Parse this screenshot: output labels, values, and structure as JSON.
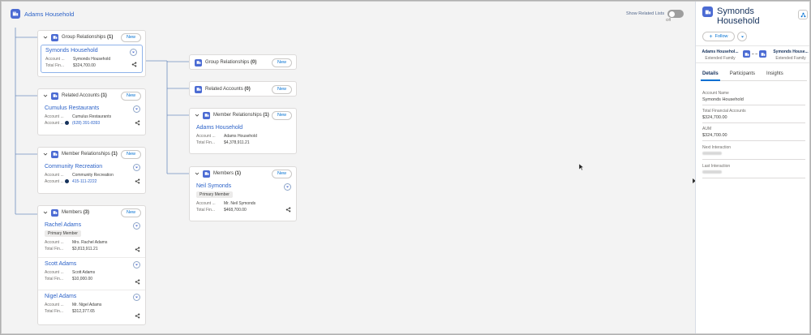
{
  "header": {
    "household_name": "Adams Household",
    "toggle_label": "Show Related Lists",
    "toggle_state": "Off"
  },
  "left_column": {
    "group_relationships": {
      "title": "Group Relationships",
      "count": "(1)",
      "new_label": "New",
      "records": [
        {
          "name": "Symonds Household",
          "lab1": "Account ...",
          "val1": "Symonds Household",
          "lab2": "Total Fin...",
          "val2": "$324,700.00"
        }
      ]
    },
    "related_accounts": {
      "title": "Related Accounts",
      "count": "(1)",
      "new_label": "New",
      "records": [
        {
          "name": "Cumulus Restaurants",
          "lab1": "Account ...",
          "val1": "Cumulus Restaurants",
          "lab2": "Account ...",
          "val2": "(628) 391-8393"
        }
      ]
    },
    "member_relationships": {
      "title": "Member Relationships",
      "count": "(1)",
      "new_label": "New",
      "records": [
        {
          "name": "Community Recreation",
          "lab1": "Account ...",
          "val1": "Community Recreation",
          "lab2": "Account ...",
          "val2": "415-111-2222"
        }
      ]
    },
    "members": {
      "title": "Members",
      "count": "(3)",
      "new_label": "New",
      "records": [
        {
          "name": "Rachel Adams",
          "badge": "Primary Member",
          "lab1": "Account ...",
          "val1": "Mrs. Rachel Adams",
          "lab2": "Total Fin...",
          "val2": "$3,813,911.21"
        },
        {
          "name": "Scott Adams",
          "lab1": "Account ...",
          "val1": "Scott Adams",
          "lab2": "Total Fin...",
          "val2": "$10,000.00"
        },
        {
          "name": "Nigel Adams",
          "lab1": "Account ...",
          "val1": "Mr. Nigel Adams",
          "lab2": "Total Fin...",
          "val2": "$312,377.65"
        }
      ]
    }
  },
  "mid_column": {
    "group_relationships": {
      "title": "Group Relationships",
      "count": "(0)",
      "new_label": "New"
    },
    "related_accounts": {
      "title": "Related Accounts",
      "count": "(0)",
      "new_label": "New"
    },
    "member_relationships": {
      "title": "Member Relationships",
      "count": "(1)",
      "new_label": "New",
      "records": [
        {
          "name": "Adams Household",
          "lab1": "Account ...",
          "val1": "Adams Household",
          "lab2": "Total Fin...",
          "val2": "$4,378,911.21"
        }
      ]
    },
    "members": {
      "title": "Members",
      "count": "(1)",
      "new_label": "New",
      "records": [
        {
          "name": "Neil Symonds",
          "badge": "Primary Member",
          "lab1": "Account ...",
          "val1": "Mr. Neil Symonds",
          "lab2": "Total Fin...",
          "val2": "$468,700.00"
        }
      ]
    }
  },
  "right_panel": {
    "title": "Symonds Household",
    "follow_label": "Follow",
    "rel_from": {
      "name": "Adams Househol...",
      "type": "Extended Family"
    },
    "rel_to": {
      "name": "Symonds House...",
      "type": "Extended Family"
    },
    "tabs": [
      {
        "label": "Details",
        "active": true
      },
      {
        "label": "Participants",
        "active": false
      },
      {
        "label": "Insights",
        "active": false
      }
    ],
    "fields": [
      {
        "label": "Account Name",
        "value": "Symonds Household"
      },
      {
        "label": "Total Financial Accounts",
        "value": "$324,700.00"
      },
      {
        "label": "AUM",
        "value": "$324,700.00"
      },
      {
        "label": "Next Interaction",
        "value": ""
      },
      {
        "label": "Last Interaction",
        "value": ""
      }
    ]
  },
  "colors": {
    "accent": "#0070d2",
    "link": "#2d63c8",
    "icon_bg": "#4b6bd3"
  }
}
